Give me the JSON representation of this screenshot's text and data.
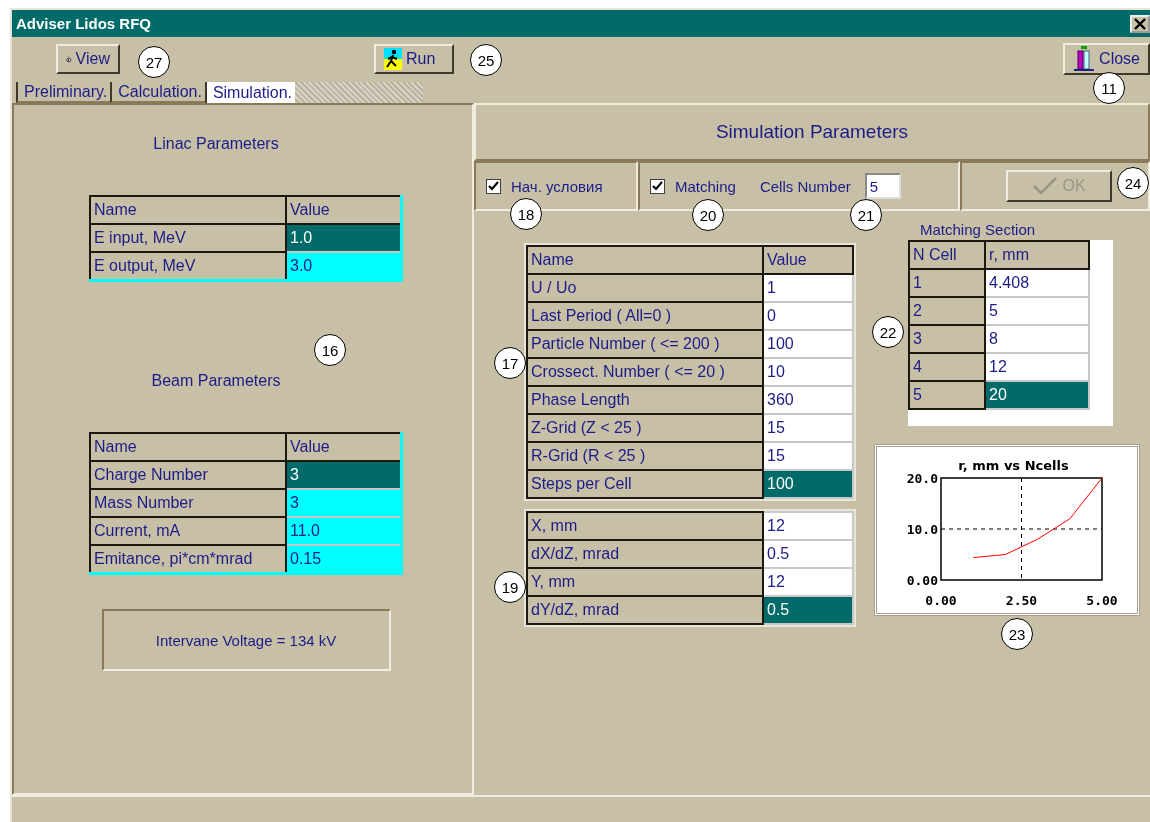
{
  "window": {
    "title": "Adviser Lidos RFQ"
  },
  "toolbar": [
    {
      "label": "View",
      "kind": "view"
    },
    {
      "label": "Run",
      "kind": "run"
    },
    {
      "label": "Close",
      "kind": "exit"
    }
  ],
  "tabs": [
    {
      "label": "Preliminary.",
      "selected": false
    },
    {
      "label": "Calculation.",
      "selected": false
    },
    {
      "label": "Simulation.",
      "selected": true
    }
  ],
  "linac": {
    "title": "Linac Parameters",
    "columns": [
      "Name",
      "Value"
    ],
    "rows": [
      {
        "name": "E input, MeV",
        "value": "1.0",
        "selected": true
      },
      {
        "name": "E output, MeV",
        "value": "3.0",
        "selected": false
      }
    ]
  },
  "beam": {
    "title": "Beam Parameters",
    "columns": [
      "Name",
      "Value"
    ],
    "rows": [
      {
        "name": "Charge Number",
        "value": "3",
        "selected": true
      },
      {
        "name": "Mass Number",
        "value": "3",
        "selected": false
      },
      {
        "name": "Current, mA",
        "value": "11.0",
        "selected": false
      },
      {
        "name": "Emitance, pi*cm*mrad",
        "value": "0.15",
        "selected": false
      }
    ]
  },
  "voltage": "Intervane Voltage =  134 kV",
  "simulation": {
    "title": "Simulation Parameters",
    "options": [
      {
        "label": "Нач. условия",
        "checked": true
      },
      {
        "label": "Matching",
        "checked": true
      }
    ],
    "cells_number": {
      "label": "Cells Number",
      "value": "5"
    },
    "ok": {
      "label": "OK",
      "disabled": true
    }
  },
  "params": {
    "columns": [
      "Name",
      "Value"
    ],
    "rows": [
      {
        "name": "U / Uo",
        "value": "1",
        "selected": false
      },
      {
        "name": "Last Period ( All=0 )",
        "value": "0",
        "selected": false
      },
      {
        "name": "Particle Number ( <= 200 )",
        "value": "100",
        "selected": false
      },
      {
        "name": "Crossect. Number ( <= 20 )",
        "value": "10",
        "selected": false
      },
      {
        "name": "Phase Length",
        "value": "360",
        "selected": false
      },
      {
        "name": "Z-Grid (Z < 25 )",
        "value": "15",
        "selected": false
      },
      {
        "name": "R-Grid (R < 25 )",
        "value": "15",
        "selected": false
      },
      {
        "name": "Steps per Cell",
        "value": "100",
        "selected": true
      }
    ]
  },
  "coords": {
    "rows": [
      {
        "name": "X, mm",
        "value": "12",
        "selected": false
      },
      {
        "name": "dX/dZ, mrad",
        "value": "0.5",
        "selected": false
      },
      {
        "name": "Y, mm",
        "value": "12",
        "selected": false
      },
      {
        "name": "dY/dZ, mrad",
        "value": "0.5",
        "selected": true
      }
    ]
  },
  "matching": {
    "title": "Matching Section",
    "columns": [
      "N Cell",
      "r, mm"
    ],
    "rows": [
      {
        "name": "1",
        "value": "4.408",
        "selected": false
      },
      {
        "name": "2",
        "value": "5",
        "selected": false
      },
      {
        "name": "3",
        "value": "8",
        "selected": false
      },
      {
        "name": "4",
        "value": "12",
        "selected": false
      },
      {
        "name": "5",
        "value": "20",
        "selected": true
      }
    ]
  },
  "chart_data": {
    "type": "line",
    "title": "r, mm vs Ncells",
    "x": [
      1,
      2,
      3,
      4,
      5
    ],
    "series": [
      {
        "color": "#ff0000",
        "values": [
          4.4,
          5,
          8,
          12,
          20
        ]
      }
    ],
    "xlim": [
      0,
      5
    ],
    "ylim": [
      0,
      20
    ],
    "xticks": [
      {
        "value": 0,
        "label": "0.00"
      },
      {
        "value": 2.5,
        "label": "2.50"
      },
      {
        "value": 5,
        "label": "5.00"
      }
    ],
    "yticks": [
      {
        "value": 0,
        "label": "0.00"
      },
      {
        "value": 10,
        "label": "10.0"
      },
      {
        "value": 20,
        "label": "20.0"
      }
    ]
  },
  "callouts": [
    {
      "text": "27"
    },
    {
      "text": "25"
    },
    {
      "text": "11"
    },
    {
      "text": "16"
    },
    {
      "text": "18"
    },
    {
      "text": "20"
    },
    {
      "text": "21"
    },
    {
      "text": "24"
    },
    {
      "text": "22"
    },
    {
      "text": "17"
    },
    {
      "text": "19"
    },
    {
      "text": "23"
    }
  ]
}
